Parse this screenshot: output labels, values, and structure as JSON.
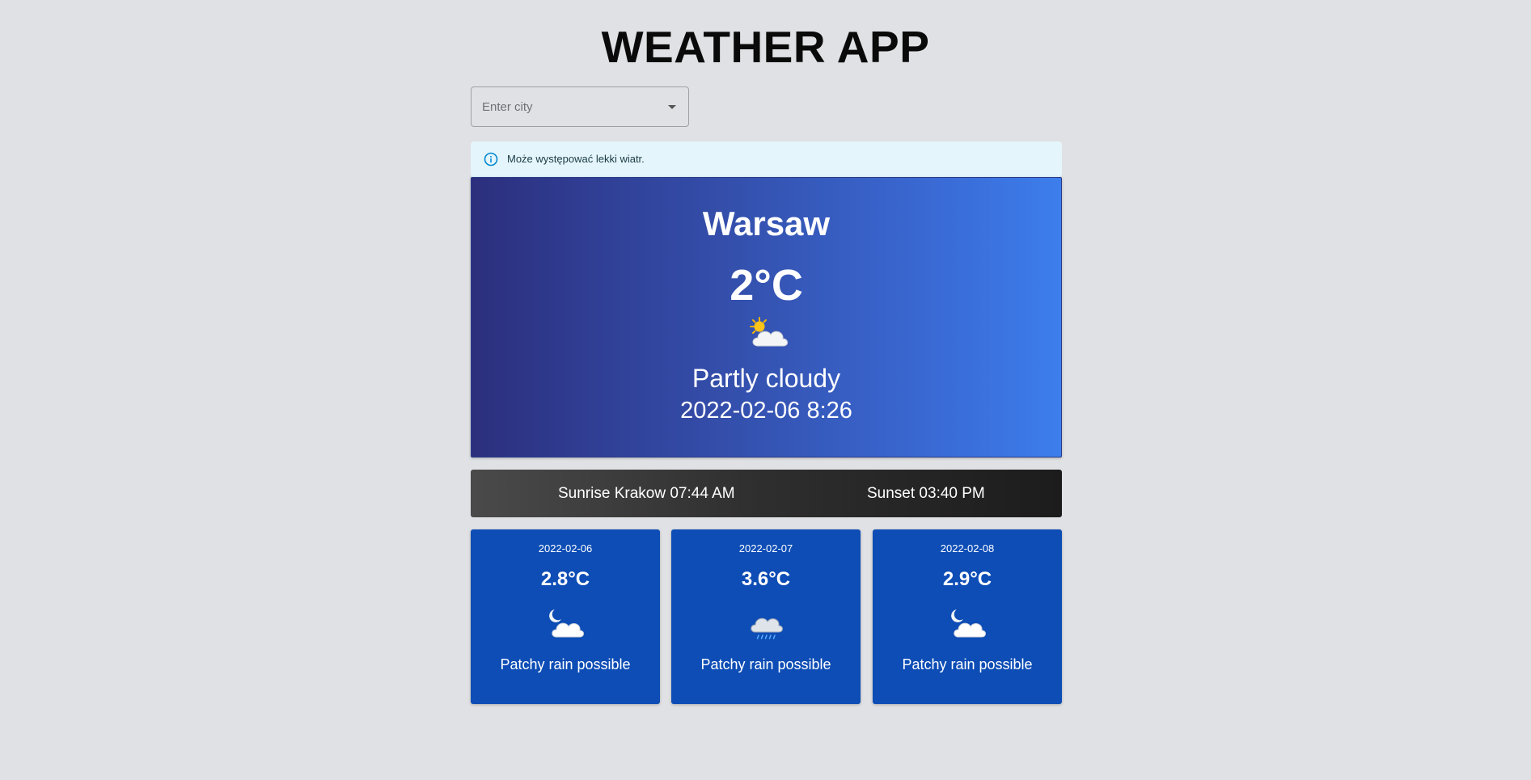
{
  "app": {
    "title": "WEATHER APP"
  },
  "search": {
    "placeholder": "Enter city"
  },
  "alert": {
    "icon": "info-icon",
    "text": "Może występować lekki wiatr."
  },
  "current": {
    "city": "Warsaw",
    "temperature": "2°C",
    "icon": "partly-cloudy-day-icon",
    "condition": "Partly cloudy",
    "datetime": "2022-02-06 8:26"
  },
  "sun": {
    "sunrise": "Sunrise Krakow 07:44 AM",
    "sunset": "Sunset 03:40 PM"
  },
  "forecast": [
    {
      "date": "2022-02-06",
      "temperature": "2.8°C",
      "icon": "partly-cloudy-night-icon",
      "condition": "Patchy rain possible"
    },
    {
      "date": "2022-02-07",
      "temperature": "3.6°C",
      "icon": "rain-cloud-icon",
      "condition": "Patchy rain possible"
    },
    {
      "date": "2022-02-08",
      "temperature": "2.9°C",
      "icon": "partly-cloudy-night-icon",
      "condition": "Patchy rain possible"
    }
  ],
  "colors": {
    "background": "#e0e1e4",
    "main_card_gradient_start": "#2c2f7c",
    "main_card_gradient_end": "#3c7eec",
    "forecast_card": "#0d4db5",
    "alert_background": "#e4f5fb",
    "alert_icon": "#0288d1"
  }
}
